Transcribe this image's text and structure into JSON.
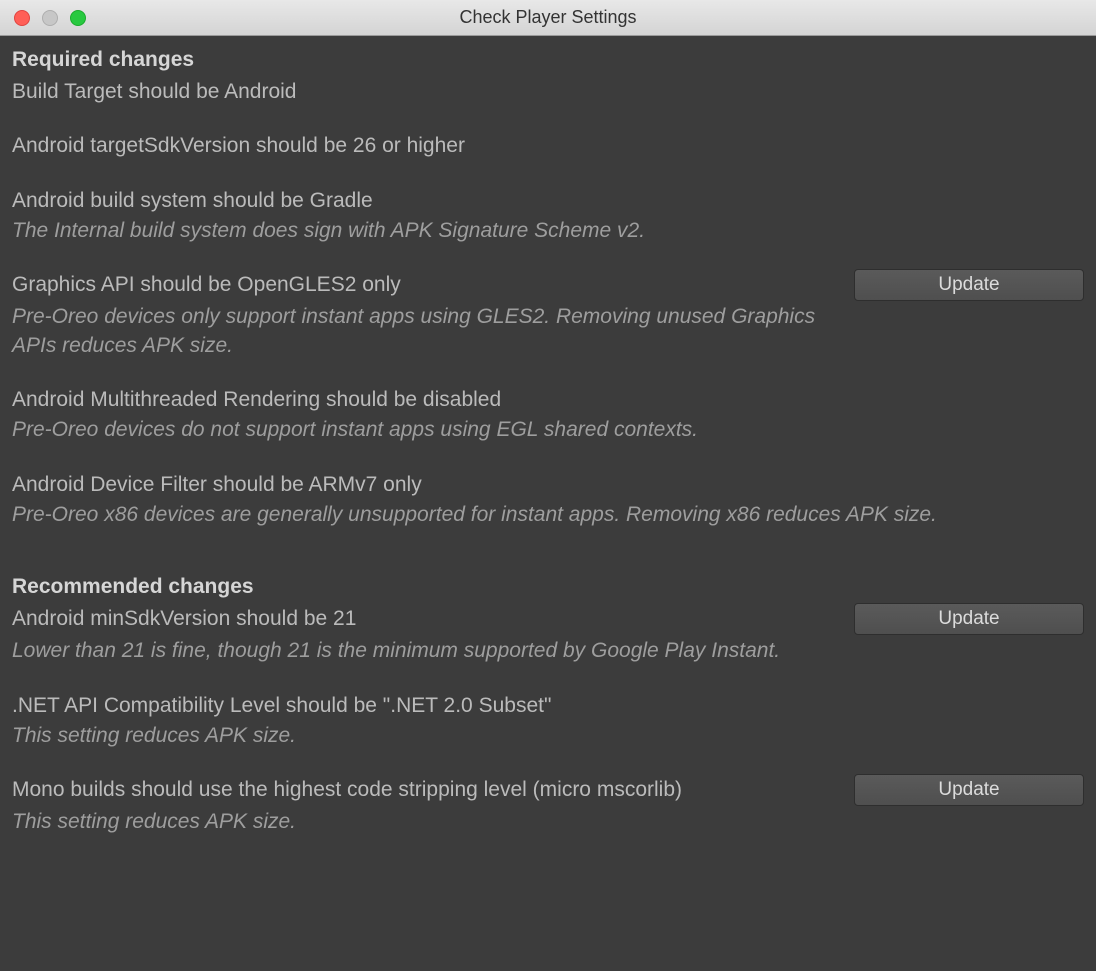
{
  "window": {
    "title": "Check Player Settings"
  },
  "sections": {
    "required": {
      "heading": "Required changes",
      "items": [
        {
          "title": "Build Target should be Android",
          "desc": null,
          "button": null
        },
        {
          "title": "Android targetSdkVersion should be 26 or higher",
          "desc": null,
          "button": null
        },
        {
          "title": "Android build system should be Gradle",
          "desc": "The Internal build system does sign with APK Signature Scheme v2.",
          "button": null
        },
        {
          "title": "Graphics API should be OpenGLES2 only",
          "desc": "Pre-Oreo devices only support instant apps using GLES2. Removing unused Graphics APIs reduces APK size.",
          "button": "Update"
        },
        {
          "title": "Android Multithreaded Rendering should be disabled",
          "desc": "Pre-Oreo devices do not support instant apps using EGL shared contexts.",
          "button": null
        },
        {
          "title": "Android Device Filter should be ARMv7 only",
          "desc": "Pre-Oreo x86 devices are generally unsupported for instant apps. Removing x86 reduces APK size.",
          "button": null
        }
      ]
    },
    "recommended": {
      "heading": "Recommended changes",
      "items": [
        {
          "title": "Android minSdkVersion should be 21",
          "desc": "Lower than 21 is fine, though 21 is the minimum supported by Google Play Instant.",
          "button": "Update"
        },
        {
          "title": ".NET API Compatibility Level should be \".NET 2.0 Subset\"",
          "desc": "This setting reduces APK size.",
          "button": null
        },
        {
          "title": "Mono builds should use the highest code stripping level (micro mscorlib)",
          "desc": "This setting reduces APK size.",
          "button": "Update"
        }
      ]
    }
  }
}
